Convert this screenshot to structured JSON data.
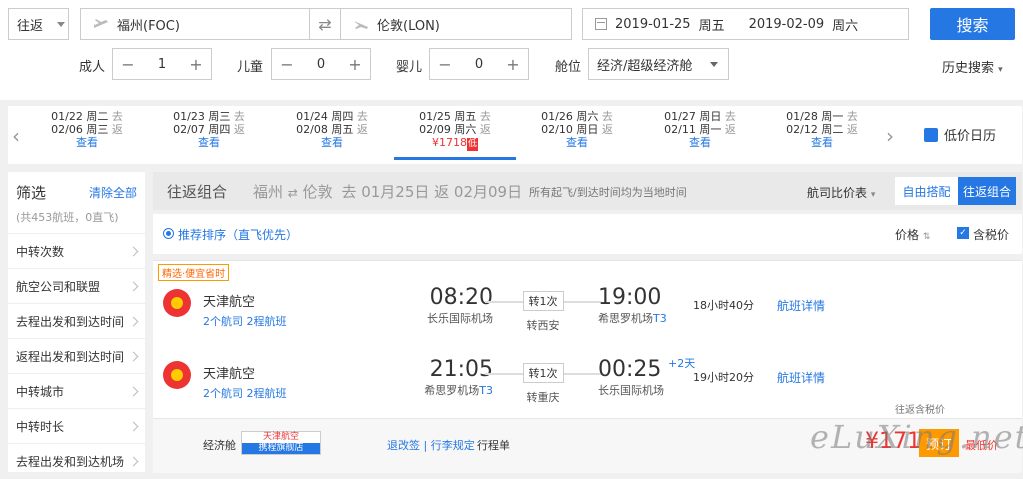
{
  "search": {
    "trip_type": "往返",
    "from": "福州(FOC)",
    "to": "伦敦(LON)",
    "depart_date": "2019-01-25",
    "depart_weekday": "周五",
    "return_date": "2019-02-09",
    "return_weekday": "周六",
    "search_label": "搜索",
    "adult_label": "成人",
    "adult_count": "1",
    "child_label": "儿童",
    "child_count": "0",
    "infant_label": "婴儿",
    "infant_count": "0",
    "cabin_label": "舱位",
    "cabin_value": "经济/超级经济舱",
    "history_label": "历史搜索"
  },
  "date_strip": {
    "cells": [
      {
        "out": "01/22",
        "out_wd": "周二",
        "out_s": "去",
        "back": "02/06",
        "back_wd": "周三",
        "back_s": "返",
        "link": "查看"
      },
      {
        "out": "01/23",
        "out_wd": "周三",
        "out_s": "去",
        "back": "02/07",
        "back_wd": "周四",
        "back_s": "返",
        "link": "查看"
      },
      {
        "out": "01/24",
        "out_wd": "周四",
        "out_s": "去",
        "back": "02/08",
        "back_wd": "周五",
        "back_s": "返",
        "link": "查看"
      },
      {
        "out": "01/25",
        "out_wd": "周五",
        "out_s": "去",
        "back": "02/09",
        "back_wd": "周六",
        "back_s": "返",
        "price": "¥1718",
        "badge": "低"
      },
      {
        "out": "01/26",
        "out_wd": "周六",
        "out_s": "去",
        "back": "02/10",
        "back_wd": "周日",
        "back_s": "返",
        "link": "查看"
      },
      {
        "out": "01/27",
        "out_wd": "周日",
        "out_s": "去",
        "back": "02/11",
        "back_wd": "周一",
        "back_s": "返",
        "link": "查看"
      },
      {
        "out": "01/28",
        "out_wd": "周一",
        "out_s": "去",
        "back": "02/12",
        "back_wd": "周二",
        "back_s": "返",
        "link": "查看"
      }
    ],
    "low_price_calendar": "低价日历"
  },
  "sidebar": {
    "title": "筛选",
    "clear": "清除全部",
    "count": "(共453航班，0直飞)",
    "filters": [
      "中转次数",
      "航空公司和联盟",
      "去程出发和到达时间",
      "返程出发和到达时间",
      "中转城市",
      "中转时长",
      "去程出发和到达机场"
    ]
  },
  "main": {
    "tab": "往返组合",
    "route_from": "福州",
    "route_to": "伦敦",
    "route_dates": "去 01月25日 返 02月09日",
    "note": "所有起飞/到达时间均为当地时间",
    "compare": "航司比价表",
    "toggle_free": "自由搭配",
    "toggle_combo": "往返组合",
    "sort_label": "推荐排序（直飞优先）",
    "price_label": "价格",
    "tax_label": "含税价"
  },
  "result": {
    "tag": "精选·便宜省时",
    "segments": [
      {
        "airline": "天津航空",
        "share": "2个航司  2程航班",
        "dep_time": "08:20",
        "dep_ap": "长乐国际机场",
        "stop": "转1次",
        "via": "转西安",
        "arr_time": "19:00",
        "arr_ap": "希思罗机场",
        "arr_term": "T3",
        "plus": "",
        "dur": "18小时40分",
        "detail": "航班详情"
      },
      {
        "airline": "天津航空",
        "share": "2个航司  2程航班",
        "dep_time": "21:05",
        "dep_ap": "希思罗机场",
        "dep_term": "T3",
        "stop": "转1次",
        "via": "转重庆",
        "arr_time": "00:25",
        "arr_ap": "长乐国际机场",
        "plus": "+2天",
        "dur": "19小时20分",
        "detail": "航班详情"
      }
    ],
    "roundtrip_tax": "往返含税价",
    "cabin": "经济舱",
    "brand_name": "天津航空",
    "brand_sub": "携程旗舰店",
    "rules": "退改签 | 行李规定",
    "itinerary": "行程单",
    "price": "¥1718",
    "book": "预订",
    "low": "最低价"
  },
  "watermark": "eLuXing.net"
}
